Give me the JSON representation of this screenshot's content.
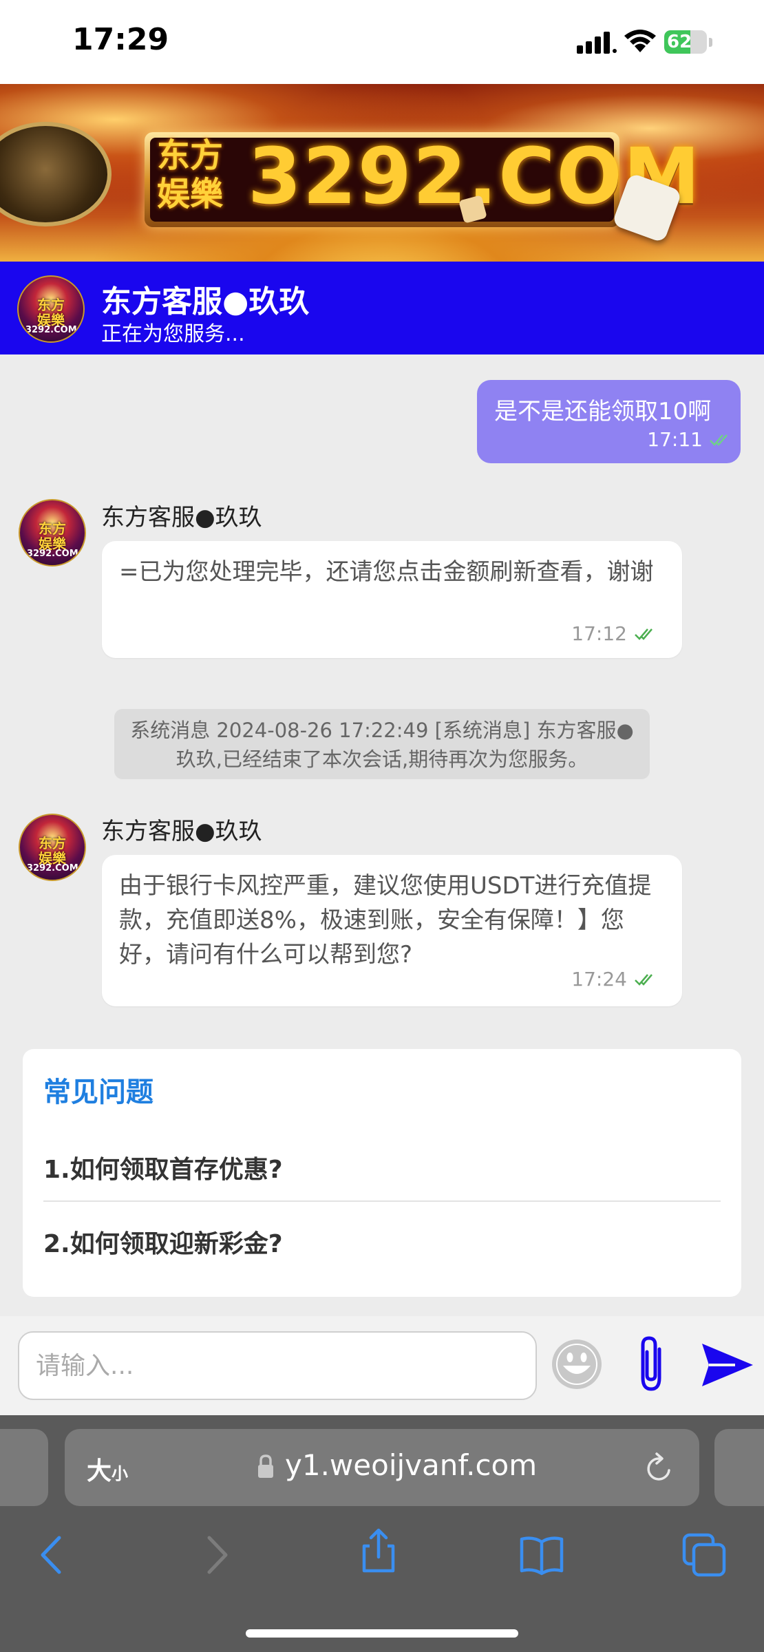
{
  "status_bar": {
    "time": "17:29",
    "battery": "62",
    "battery_level": 0.62
  },
  "banner": {
    "brand_text": "东方\n娱樂",
    "number_text": "3292.COM"
  },
  "header": {
    "title": "东方客服●玖玖",
    "status": "正在为您服务..."
  },
  "avatar": {
    "label": "东方\n娱樂",
    "sub": "3292.COM"
  },
  "messages": [
    {
      "direction": "out",
      "text": "是不是还能领取10啊",
      "time": "17:11"
    },
    {
      "direction": "in",
      "sender": "东方客服●玖玖",
      "text": "=已为您处理完毕，还请您点击金额刷新查看，谢谢",
      "time": "17:12"
    },
    {
      "direction": "system",
      "text": "系统消息 2024-08-26 17:22:49 [系统消息] 东方客服●玖玖,已经结束了本次会话,期待再次为您服务。"
    },
    {
      "direction": "in",
      "sender": "东方客服●玖玖",
      "text": "由于银行卡风控严重，建议您使用USDT进行充值提款，充值即送8%，极速到账，安全有保障！】您好，请问有什么可以帮到您?",
      "time": "17:24"
    }
  ],
  "faq": {
    "title": "常见问题",
    "items": [
      "1.如何领取首存优惠?",
      "2.如何领取迎新彩金?"
    ]
  },
  "composer": {
    "placeholder": "请输入..."
  },
  "browser": {
    "text_size_label": "大",
    "text_size_small": "小",
    "url": "y1.weoijvanf.com"
  },
  "colors": {
    "header_bg": "#1a06ee",
    "outgoing_bubble": "#8f82f2",
    "faq_title": "#1f7fe0",
    "send_icon": "#1a06ee",
    "read_check": "#4caf50"
  },
  "icons": [
    "signal-icon",
    "wifi-icon",
    "battery-icon",
    "emoji-icon",
    "paperclip-icon",
    "send-icon",
    "lock-icon",
    "reload-icon",
    "back-icon",
    "forward-icon",
    "share-icon",
    "bookmarks-icon",
    "tabs-icon"
  ]
}
